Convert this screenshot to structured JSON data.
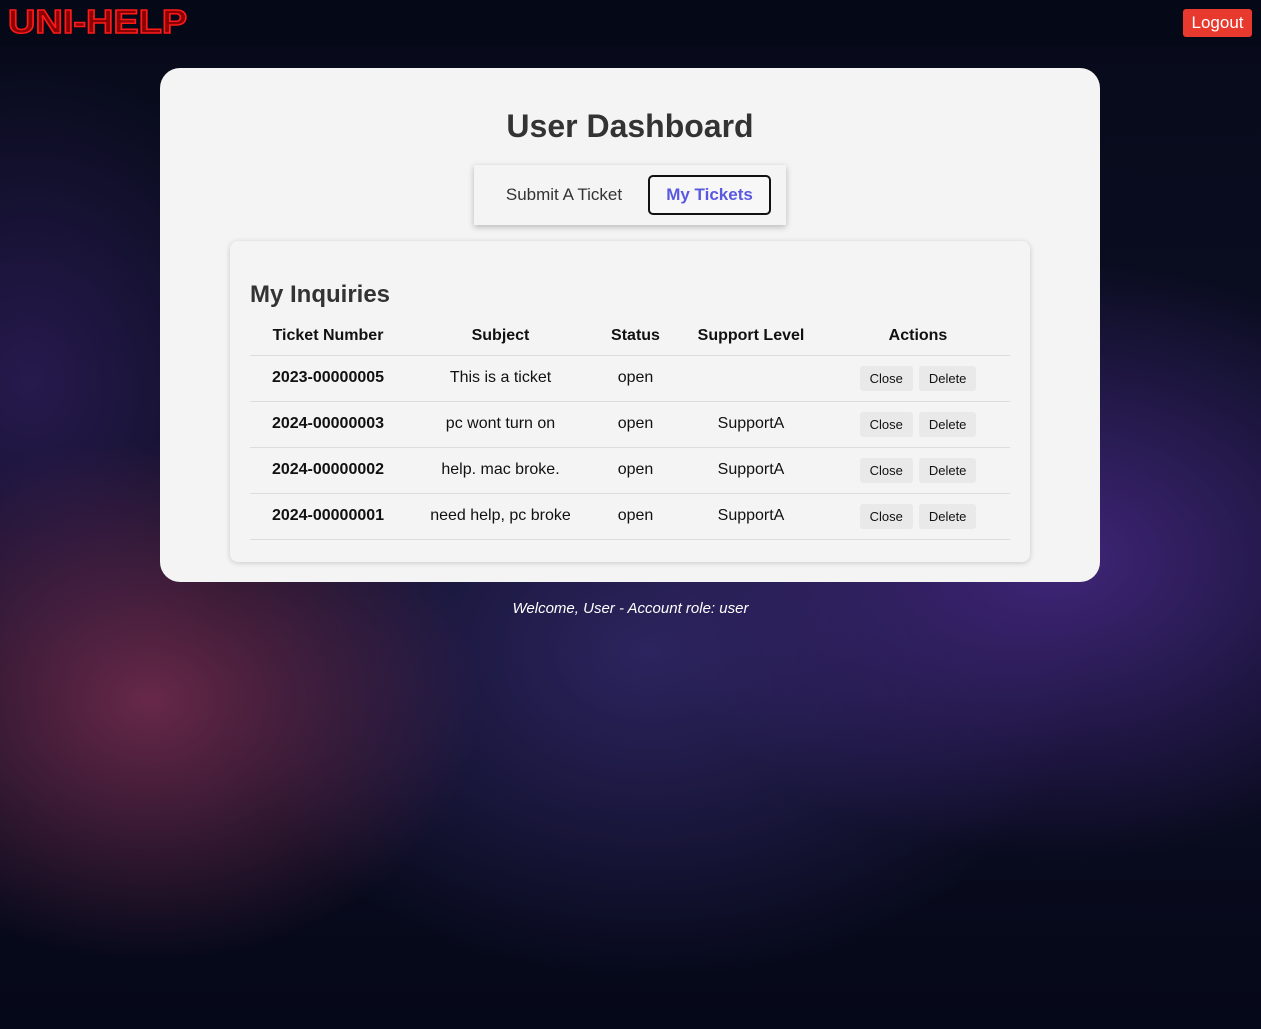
{
  "header": {
    "logo_text": "UNI-HELP",
    "logout_label": "Logout",
    "colors": {
      "logout_bg": "#e8392f",
      "logo": "#ff1a1a"
    }
  },
  "dashboard": {
    "title": "User Dashboard",
    "tabs": [
      {
        "label": "Submit A Ticket",
        "active": false
      },
      {
        "label": "My Tickets",
        "active": true
      }
    ],
    "accent_color": "#5a58e0"
  },
  "inquiries": {
    "title": "My Inquiries",
    "columns": [
      "Ticket Number",
      "Subject",
      "Status",
      "Support Level",
      "Actions"
    ],
    "rows": [
      {
        "ticket_number": "2023-00000005",
        "subject": "This is a ticket",
        "status": "open",
        "support_level": "",
        "actions": [
          "Close",
          "Delete"
        ]
      },
      {
        "ticket_number": "2024-00000003",
        "subject": "pc wont turn on",
        "status": "open",
        "support_level": "SupportA",
        "actions": [
          "Close",
          "Delete"
        ]
      },
      {
        "ticket_number": "2024-00000002",
        "subject": "help. mac broke.",
        "status": "open",
        "support_level": "SupportA",
        "actions": [
          "Close",
          "Delete"
        ]
      },
      {
        "ticket_number": "2024-00000001",
        "subject": "need help, pc broke",
        "status": "open",
        "support_level": "SupportA",
        "actions": [
          "Close",
          "Delete"
        ]
      }
    ]
  },
  "footer": {
    "welcome_text": "Welcome, User - Account role: user"
  }
}
